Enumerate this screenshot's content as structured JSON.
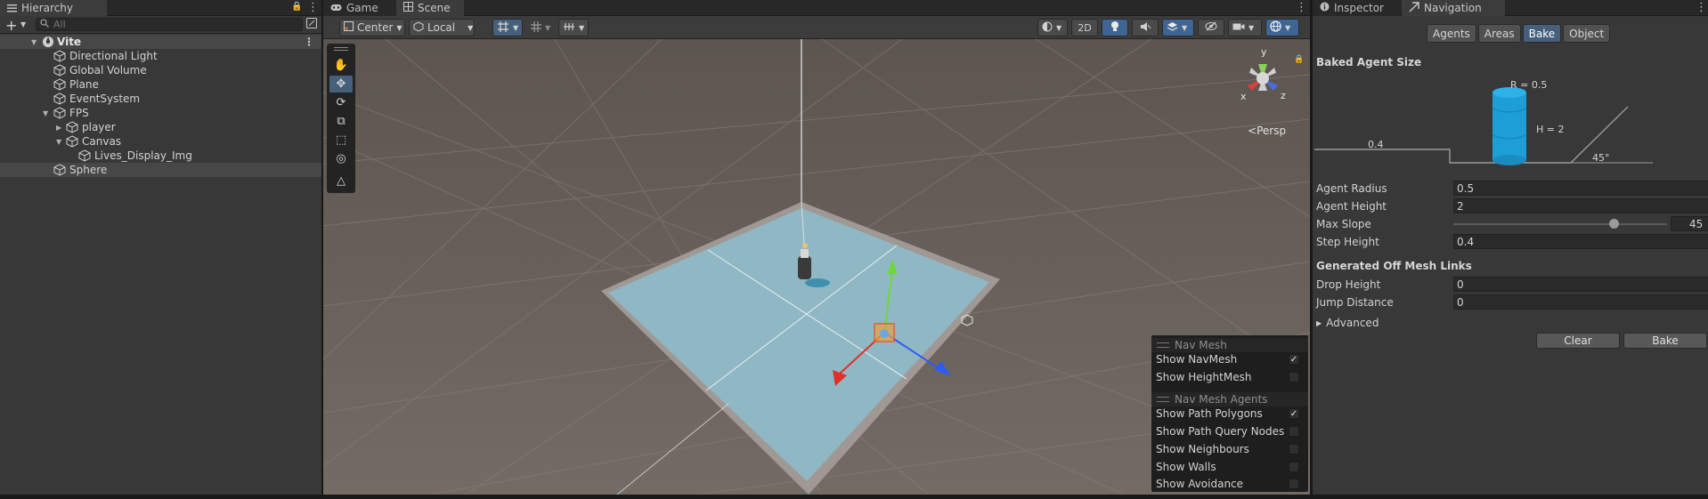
{
  "hierarchy": {
    "tab_label": "Hierarchy",
    "search_placeholder": "All",
    "scene_name": "Vite",
    "items": [
      {
        "label": "Directional Light"
      },
      {
        "label": "Global Volume"
      },
      {
        "label": "Plane"
      },
      {
        "label": "EventSystem"
      },
      {
        "label": "FPS"
      },
      {
        "label": "player"
      },
      {
        "label": "Canvas"
      },
      {
        "label": "Lives_Display_Img"
      },
      {
        "label": "Sphere"
      }
    ]
  },
  "scene_view": {
    "tabs": [
      {
        "label": "Game"
      },
      {
        "label": "Scene"
      }
    ],
    "toolbar": {
      "pivot_mode": "Center",
      "pivot_rotation": "Local",
      "mode_2d": "2D"
    },
    "gizmo": {
      "axis_x": "x",
      "axis_y": "y",
      "axis_z": "z",
      "projection": "Persp"
    },
    "nav_overlay": {
      "nav_mesh_header": "Nav Mesh",
      "show_navmesh": "Show NavMesh",
      "show_navmesh_checked": true,
      "show_heightmesh": "Show HeightMesh",
      "show_heightmesh_checked": false,
      "agents_header": "Nav Mesh Agents",
      "show_path_polygons": "Show Path Polygons",
      "show_path_polygons_checked": true,
      "show_path_query_nodes": "Show Path Query Nodes",
      "show_neighbours": "Show Neighbours",
      "show_walls": "Show Walls",
      "show_avoidance": "Show Avoidance"
    }
  },
  "inspector": {
    "tabs": [
      {
        "label": "Inspector"
      },
      {
        "label": "Navigation"
      }
    ],
    "nav_tabs": [
      {
        "label": "Agents"
      },
      {
        "label": "Areas"
      },
      {
        "label": "Bake"
      },
      {
        "label": "Object"
      }
    ],
    "active_nav_tab": "Bake",
    "baked_agent_size": {
      "header": "Baked Agent Size",
      "radius_label": "R = 0.5",
      "height_label": "H = 2",
      "step_label": "0.4",
      "slope_label": "45°"
    },
    "fields": {
      "agent_radius_label": "Agent Radius",
      "agent_radius": "0.5",
      "agent_height_label": "Agent Height",
      "agent_height": "2",
      "max_slope_label": "Max Slope",
      "max_slope": "45",
      "max_slope_fraction": 0.75,
      "step_height_label": "Step Height",
      "step_height": "0.4"
    },
    "offmesh": {
      "header": "Generated Off Mesh Links",
      "drop_height_label": "Drop Height",
      "drop_height": "0",
      "jump_distance_label": "Jump Distance",
      "jump_distance": "0"
    },
    "advanced_label": "Advanced",
    "clear_label": "Clear",
    "bake_label": "Bake"
  },
  "colors": {
    "selection_blue": "#46607c",
    "navmesh_fill": "#8fb8c6",
    "agent_cylinder": "#1e9ed6"
  }
}
